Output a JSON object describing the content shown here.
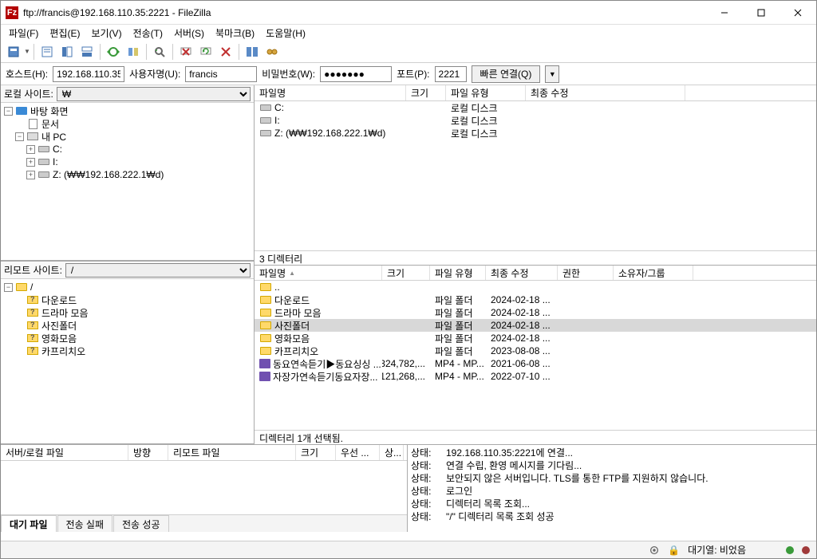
{
  "title": "ftp://francis@192.168.110.35:2221 - FileZilla",
  "menu": [
    "파일(F)",
    "편집(E)",
    "보기(V)",
    "전송(T)",
    "서버(S)",
    "북마크(B)",
    "도움말(H)"
  ],
  "qc": {
    "host_label": "호스트(H):",
    "host": "192.168.110.35",
    "user_label": "사용자명(U):",
    "user": "francis",
    "pass_label": "비밀번호(W):",
    "pass": "●●●●●●●",
    "port_label": "포트(P):",
    "port": "2221",
    "connect": "빠른 연결(Q)"
  },
  "local": {
    "label": "로컬 사이트:",
    "path": "₩",
    "tree": [
      {
        "indent": 0,
        "toggle": "-",
        "icon": "desktop",
        "label": "바탕 화면"
      },
      {
        "indent": 1,
        "toggle": "",
        "icon": "doc",
        "label": "문서"
      },
      {
        "indent": 1,
        "toggle": "-",
        "icon": "pc",
        "label": "내 PC"
      },
      {
        "indent": 2,
        "toggle": "+",
        "icon": "drive",
        "label": "C:"
      },
      {
        "indent": 2,
        "toggle": "+",
        "icon": "drive",
        "label": "I:"
      },
      {
        "indent": 2,
        "toggle": "+",
        "icon": "drive",
        "label": "Z: (₩₩192.168.222.1₩d)"
      }
    ]
  },
  "remote": {
    "label": "리모트 사이트:",
    "path": "/",
    "tree": [
      {
        "indent": 0,
        "toggle": "-",
        "icon": "folder",
        "label": "/"
      },
      {
        "indent": 1,
        "toggle": "",
        "icon": "folder-q",
        "label": "다운로드"
      },
      {
        "indent": 1,
        "toggle": "",
        "icon": "folder-q",
        "label": "드라마 모음"
      },
      {
        "indent": 1,
        "toggle": "",
        "icon": "folder-q",
        "label": "사진폴더"
      },
      {
        "indent": 1,
        "toggle": "",
        "icon": "folder-q",
        "label": "영화모음"
      },
      {
        "indent": 1,
        "toggle": "",
        "icon": "folder-q",
        "label": "카프리치오"
      }
    ]
  },
  "local_list": {
    "cols": [
      "파일명",
      "크기",
      "파일 유형",
      "최종 수정"
    ],
    "rows": [
      {
        "icon": "drive",
        "name": "C:",
        "size": "",
        "type": "로컬 디스크",
        "mod": ""
      },
      {
        "icon": "drive",
        "name": "I:",
        "size": "",
        "type": "로컬 디스크",
        "mod": ""
      },
      {
        "icon": "drive",
        "name": "Z: (₩₩192.168.222.1₩d)",
        "size": "",
        "type": "로컬 디스크",
        "mod": ""
      }
    ],
    "status": "3 디렉터리"
  },
  "remote_list": {
    "cols": [
      "파일명",
      "크기",
      "파일 유형",
      "최종 수정",
      "권한",
      "소유자/그룹"
    ],
    "rows": [
      {
        "icon": "folder",
        "name": "..",
        "size": "",
        "type": "",
        "mod": "",
        "sel": false
      },
      {
        "icon": "folder",
        "name": "다운로드",
        "size": "",
        "type": "파일 폴더",
        "mod": "2024-02-18 ...",
        "sel": false
      },
      {
        "icon": "folder",
        "name": "드라마 모음",
        "size": "",
        "type": "파일 폴더",
        "mod": "2024-02-18 ...",
        "sel": false
      },
      {
        "icon": "folder",
        "name": "사진폴더",
        "size": "",
        "type": "파일 폴더",
        "mod": "2024-02-18 ...",
        "sel": true
      },
      {
        "icon": "folder",
        "name": "영화모음",
        "size": "",
        "type": "파일 폴더",
        "mod": "2024-02-18 ...",
        "sel": false
      },
      {
        "icon": "folder",
        "name": "카프리치오",
        "size": "",
        "type": "파일 폴더",
        "mod": "2023-08-08 ...",
        "sel": false
      },
      {
        "icon": "video",
        "name": "동요연속듣기▶동요싱싱 ...",
        "size": "324,782,...",
        "type": "MP4 - MP...",
        "mod": "2021-06-08 ...",
        "sel": false
      },
      {
        "icon": "video",
        "name": "자장가연속듣기동요자장...",
        "size": "121,268,...",
        "type": "MP4 - MP...",
        "mod": "2022-07-10 ...",
        "sel": false
      }
    ],
    "status": "디렉터리 1개 선택됨."
  },
  "queue": {
    "cols": [
      "서버/로컬 파일",
      "방향",
      "리모트 파일",
      "크기",
      "우선 ...",
      "상..."
    ],
    "tabs": [
      "대기 파일",
      "전송 실패",
      "전송 성공"
    ]
  },
  "log": [
    {
      "label": "상태:",
      "text": "192.168.110.35:2221에 연결..."
    },
    {
      "label": "상태:",
      "text": "연결 수립, 환영 메시지를 기다림..."
    },
    {
      "label": "상태:",
      "text": "보안되지 않은 서버입니다. TLS를 통한 FTP를 지원하지 않습니다."
    },
    {
      "label": "상태:",
      "text": "로그인"
    },
    {
      "label": "상태:",
      "text": "디렉터리 목록 조회..."
    },
    {
      "label": "상태:",
      "text": "\"/\" 디렉터리 목록 조회 성공"
    }
  ],
  "statusbar": {
    "queue": "대기열: 비었음"
  }
}
